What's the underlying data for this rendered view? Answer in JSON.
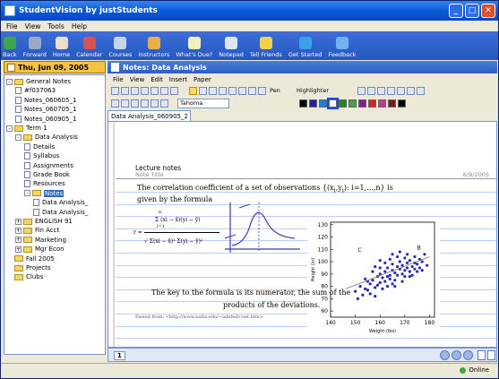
{
  "window": {
    "title": "StudentVision by justStudents"
  },
  "menu": [
    "File",
    "View",
    "Tools",
    "Help"
  ],
  "toolbar": [
    {
      "label": "Back",
      "icon": "back-arrow-icon",
      "color": "#3da64a"
    },
    {
      "label": "Forward",
      "icon": "forward-arrow-icon",
      "color": "#9aa9c9"
    },
    {
      "label": "Home",
      "icon": "home-icon",
      "color": "#e8e0c8"
    },
    {
      "label": "Calendar",
      "icon": "calendar-icon",
      "color": "#d9534f"
    },
    {
      "label": "Courses",
      "icon": "courses-icon",
      "color": "#c8d4ee"
    },
    {
      "label": "Instructors",
      "icon": "instructors-icon",
      "color": "#e8b04a"
    },
    {
      "label": "What's Due?",
      "icon": "whats-due-icon",
      "color": "#f6f0c0"
    },
    {
      "label": "Notepad",
      "icon": "notepad-icon",
      "color": "#dfe6f2"
    },
    {
      "label": "Tell Friends",
      "icon": "tell-friends-icon",
      "color": "#f2d04a"
    },
    {
      "label": "Get Started",
      "icon": "info-icon",
      "color": "#3aa0e8"
    },
    {
      "label": "Feedback",
      "icon": "feedback-icon",
      "color": "#6fb4f0"
    }
  ],
  "left_panel": {
    "date": "Thu, Jun 09, 2005",
    "tree": [
      {
        "label": "General Notes",
        "type": "folder",
        "indent": 0,
        "expander": "-"
      },
      {
        "label": "#f037063",
        "type": "doc",
        "indent": 1
      },
      {
        "label": "Notes_060605_1",
        "type": "doc",
        "indent": 1
      },
      {
        "label": "Notes_060705_1",
        "type": "doc",
        "indent": 1
      },
      {
        "label": "Notes_060905_1",
        "type": "doc",
        "indent": 1
      },
      {
        "label": "Term 1",
        "type": "folder",
        "indent": 0,
        "expander": "-"
      },
      {
        "label": "Data Analysis",
        "type": "folder",
        "indent": 1,
        "expander": "-"
      },
      {
        "label": "Details",
        "type": "doc",
        "indent": 2
      },
      {
        "label": "Syllabus",
        "type": "doc",
        "indent": 2
      },
      {
        "label": "Assignments",
        "type": "doc",
        "indent": 2
      },
      {
        "label": "Grade Book",
        "type": "doc",
        "indent": 2
      },
      {
        "label": "Resources",
        "type": "doc",
        "indent": 2
      },
      {
        "label": "Notes",
        "type": "folder",
        "indent": 2,
        "expander": "-",
        "selected": true
      },
      {
        "label": "Data Analysis_",
        "type": "doc",
        "indent": 3
      },
      {
        "label": "Data Analysis_",
        "type": "doc",
        "indent": 3
      },
      {
        "label": "ENGLISH 91",
        "type": "folder",
        "indent": 1,
        "expander": "+"
      },
      {
        "label": "Fin Acct",
        "type": "folder",
        "indent": 1,
        "expander": "+"
      },
      {
        "label": "Marketing",
        "type": "folder",
        "indent": 1,
        "expander": "+"
      },
      {
        "label": "Mgr Econ",
        "type": "folder",
        "indent": 1,
        "expander": "+"
      },
      {
        "label": "Fall 2005",
        "type": "folder",
        "indent": 0,
        "expander": ""
      },
      {
        "label": "Projects",
        "type": "folder",
        "indent": 0,
        "expander": ""
      },
      {
        "label": "Clubs",
        "type": "folder",
        "indent": 0,
        "expander": ""
      }
    ]
  },
  "notes_panel": {
    "header": "Notes: Data Analysis",
    "menu": [
      "File",
      "View",
      "Edit",
      "Insert",
      "Paper"
    ],
    "font_name": "Tahoma",
    "pen_label": "Pen",
    "highlighter_label": "Highlighter",
    "colors": [
      "#000000",
      "#1e1e9e",
      "#1a7fe0",
      "#ffffff",
      "#1b8a1b",
      "#4a9a4a",
      "#8a1b8a",
      "#e02020",
      "#c03a9a",
      "#7a1b1b",
      "#000000"
    ],
    "tab_label": "Data Analysis_060905_2",
    "page_tab": "1"
  },
  "note": {
    "heading": "Lecture notes",
    "title_placeholder": "Note Title",
    "date": "6/9/2005",
    "line1": "The correlation coefficient of a set of observations {(x",
    "line1_sub": "i",
    "line1_mid": ",y",
    "line1_sub2": "i",
    "line1_end": "): i=1,...,n} is",
    "line2": "given by the formula",
    "formula_r": "r =",
    "formula_num": "Σ (x",
    "formula_num_rest": "i − x̄)(y",
    "formula_num_end": "i − ȳ)",
    "formula_den": "√ Σ(x",
    "formula_den_mid": "i − x̄)² Σ(y",
    "formula_den_end": "i − ȳ)²",
    "formula_lim_top": "n",
    "formula_lim_bot": "i=1",
    "key1": "The key to the formula is its numerator, the sum of the",
    "key2": "products of the deviations.",
    "pasted": "Pasted from: <http://www.nafta.edu/~adafed/cont.htm>"
  },
  "scatter": {
    "ylabel": "Height (in)",
    "xlabel": "Weight (lbs)",
    "yticks": [
      "130",
      "120",
      "110",
      "100",
      "90",
      "80",
      "70",
      "60"
    ],
    "xticks": [
      "140",
      "150",
      "160",
      "170",
      "180"
    ],
    "xlim": [
      140,
      182
    ],
    "ylim": [
      55,
      132
    ],
    "point_color": "#2a2aaa",
    "points": [
      [
        150,
        76
      ],
      [
        152,
        80
      ],
      [
        154,
        78
      ],
      [
        155,
        84
      ],
      [
        156,
        82
      ],
      [
        157,
        85
      ],
      [
        158,
        79
      ],
      [
        159,
        88
      ],
      [
        160,
        83
      ],
      [
        160,
        90
      ],
      [
        161,
        87
      ],
      [
        162,
        92
      ],
      [
        162,
        84
      ],
      [
        163,
        95
      ],
      [
        164,
        89
      ],
      [
        164,
        86
      ],
      [
        165,
        93
      ],
      [
        165,
        98
      ],
      [
        166,
        91
      ],
      [
        166,
        85
      ],
      [
        167,
        96
      ],
      [
        167,
        89
      ],
      [
        168,
        94
      ],
      [
        168,
        100
      ],
      [
        169,
        90
      ],
      [
        169,
        97
      ],
      [
        170,
        93
      ],
      [
        170,
        88
      ],
      [
        171,
        99
      ],
      [
        171,
        95
      ],
      [
        172,
        92
      ],
      [
        172,
        101
      ],
      [
        173,
        96
      ],
      [
        174,
        94
      ],
      [
        174,
        104
      ],
      [
        175,
        98
      ],
      [
        176,
        102
      ],
      [
        176,
        95
      ],
      [
        177,
        100
      ],
      [
        178,
        106
      ],
      [
        158,
        72
      ],
      [
        153,
        73
      ],
      [
        161,
        78
      ],
      [
        163,
        80
      ],
      [
        166,
        80
      ],
      [
        160,
        95
      ],
      [
        164,
        102
      ],
      [
        168,
        108
      ],
      [
        170,
        103
      ],
      [
        157,
        92
      ],
      [
        162,
        99
      ],
      [
        159,
        81
      ],
      [
        155,
        77
      ],
      [
        173,
        89
      ],
      [
        175,
        92
      ],
      [
        167,
        104
      ],
      [
        169,
        84
      ],
      [
        172,
        88
      ],
      [
        165,
        82
      ],
      [
        163,
        88
      ],
      [
        154,
        86
      ],
      [
        151,
        70
      ],
      [
        179,
        97
      ],
      [
        177,
        93
      ],
      [
        156,
        74
      ],
      [
        165,
        106
      ],
      [
        160,
        101
      ],
      [
        171,
        106
      ],
      [
        174,
        99
      ],
      [
        158,
        96
      ]
    ],
    "fit_line": [
      [
        146,
        78
      ],
      [
        180,
        104
      ]
    ],
    "outlier_labels": [
      "C",
      "B"
    ]
  },
  "status": {
    "online": "Online"
  }
}
